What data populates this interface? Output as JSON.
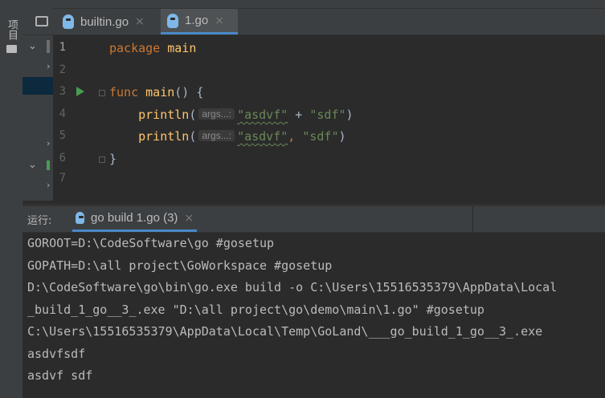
{
  "left_rail": {
    "label": "项目"
  },
  "tabs": [
    {
      "label": "builtin.go",
      "close": "×"
    },
    {
      "label": "1.go",
      "close": "×"
    }
  ],
  "gutter": [
    "1",
    "2",
    "3",
    "4",
    "5",
    "6",
    "7"
  ],
  "code": {
    "line1": {
      "kw": "package",
      "name": "main"
    },
    "line3": {
      "kw": "func",
      "name": "main",
      "rest": "() {"
    },
    "line4": {
      "fn": "println",
      "open": "(",
      "hint": "args...:",
      "s1": "\"asdvf\"",
      "op": " + ",
      "s2": "\"sdf\"",
      "close": ")"
    },
    "line5": {
      "fn": "println",
      "open": "(",
      "hint": "args...:",
      "s1": "\"asdvf\"",
      "sep": ", ",
      "s2": "\"sdf\"",
      "close": ")"
    },
    "line6": {
      "text": "}"
    }
  },
  "run_panel": {
    "label": "运行:",
    "tab_label": "go build 1.go (3)",
    "tab_close": "×"
  },
  "console": [
    "GOROOT=D:\\CodeSoftware\\go #gosetup",
    "GOPATH=D:\\all project\\GoWorkspace #gosetup",
    "D:\\CodeSoftware\\go\\bin\\go.exe build -o C:\\Users\\15516535379\\AppData\\Local",
    "_build_1_go__3_.exe \"D:\\all project\\go\\demo\\main\\1.go\" #gosetup",
    "C:\\Users\\15516535379\\AppData\\Local\\Temp\\GoLand\\___go_build_1_go__3_.exe",
    "asdvfsdf",
    "asdvf sdf"
  ],
  "colors": {
    "background": "#2b2b2b",
    "panel": "#3c3f41",
    "keyword": "#cc7832",
    "function": "#ffc66d",
    "string": "#6a8759",
    "accent": "#4a88c7",
    "run_icon": "#499c54"
  }
}
